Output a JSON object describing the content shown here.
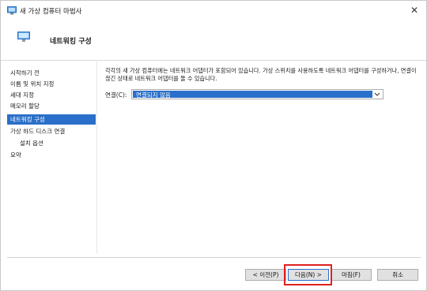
{
  "window": {
    "title": "새 가상 컴퓨터 마법사",
    "close_glyph": "✕"
  },
  "header": {
    "title": "네트워킹 구성",
    "icon": "network-adapter-icon"
  },
  "sidebar": {
    "items": [
      {
        "label": "시작하기 전",
        "active": false
      },
      {
        "label": "이름 및 위치 지정",
        "active": false
      },
      {
        "label": "세대 지정",
        "active": false
      },
      {
        "label": "메모리 할당",
        "active": false
      },
      {
        "label": "네트워킹 구성",
        "active": true
      },
      {
        "label": "가상 하드 디스크 연결",
        "active": false
      },
      {
        "label": "설치 옵션",
        "active": false
      },
      {
        "label": "요약",
        "active": false
      }
    ]
  },
  "main": {
    "description": "각각의 새 가상 컴퓨터에는 네트워크 어댑터가 포함되어 있습니다. 가상 스위치를 사용하도록 네트워크 어댑터를 구성하거나, 연결이 끊긴 상태로 네트워크 어댑터를 둘 수 있습니다.",
    "connection_label": "연결(C):",
    "connection_value": "연결되지 않음"
  },
  "buttons": {
    "previous": "< 이전(P)",
    "next": "다음(N) >",
    "finish": "마침(F)",
    "cancel": "취소"
  },
  "colors": {
    "accent": "#2a6fc9",
    "highlight": "#e02020"
  }
}
